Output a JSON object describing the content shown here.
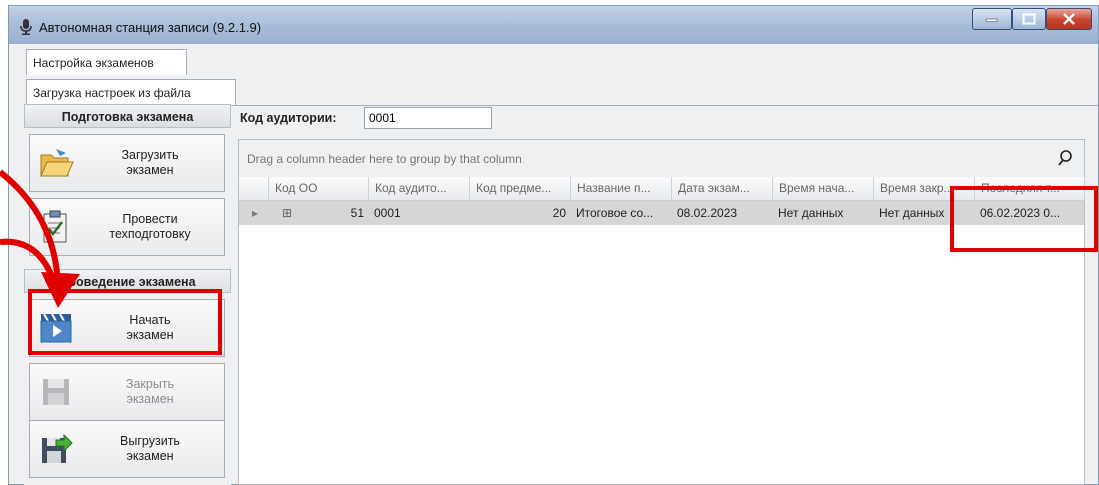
{
  "window": {
    "title": "Автономная станция записи (9.2.1.9)"
  },
  "tabs": [
    {
      "label": "Настройка экзаменов"
    },
    {
      "label": "Загрузка настроек из файла"
    }
  ],
  "left_panel": {
    "section1_title": "Подготовка экзамена",
    "load_exam": "Загрузить\nэкзамен",
    "tech_prep": "Провести\nтехподготовку",
    "section2_title": "Проведение экзамена",
    "start_exam": "Начать\nэкзамен",
    "close_exam": "Закрыть\nэкзамен",
    "export_exam": "Выгрузить\nэкзамен"
  },
  "auditorium": {
    "label": "Код аудитории:",
    "value": "0001"
  },
  "grid": {
    "group_hint": "Drag a column header here to group by that column",
    "columns": [
      "Код ОО",
      "Код аудито...",
      "Код предме...",
      "Название п...",
      "Дата экзам...",
      "Время нача...",
      "Время закр...",
      "Последняя т..."
    ],
    "rows": [
      {
        "expand": "⊞",
        "oo": "51",
        "aud": "0001",
        "subj": "20",
        "name": "Итоговое со...",
        "date": "08.02.2023",
        "start": "Нет данных",
        "end": "Нет данных",
        "last": "06.02.2023 0..."
      }
    ]
  },
  "colors": {
    "highlight": "#e00000",
    "title_bar": "#a9bdd8",
    "close_button": "#c9442e"
  }
}
